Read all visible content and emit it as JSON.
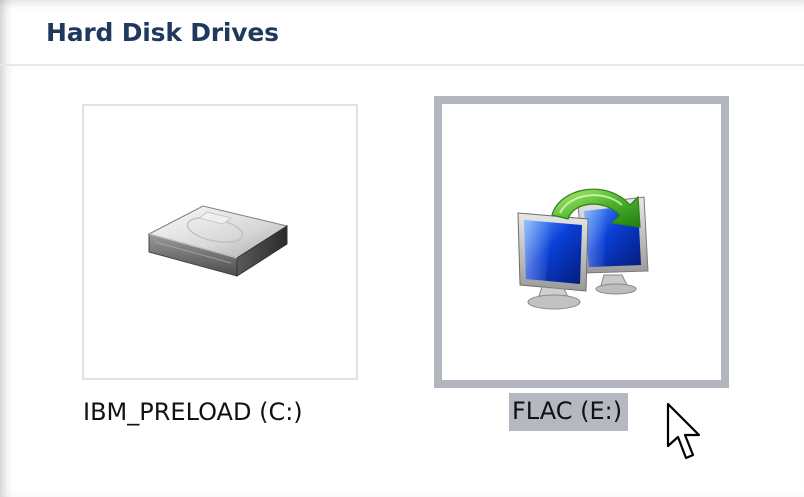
{
  "group": {
    "title": "Hard Disk Drives"
  },
  "drives": [
    {
      "label": "IBM_PRELOAD (C:)",
      "icon": "hard-drive-icon",
      "selected": false
    },
    {
      "label": "FLAC (E:)",
      "icon": "sync-network-drive-icon",
      "selected": true
    }
  ],
  "cursor": {
    "icon": "mouse-pointer-icon"
  }
}
